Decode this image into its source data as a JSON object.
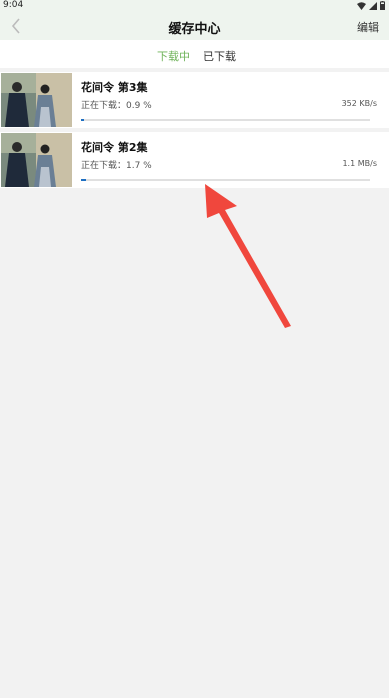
{
  "status_bar": {
    "time": "9:04"
  },
  "header": {
    "title": "缓存中心",
    "edit_label": "编辑"
  },
  "tabs": [
    {
      "label": "下载中",
      "active": true
    },
    {
      "label": "已下载",
      "active": false
    }
  ],
  "downloads": [
    {
      "title": "花间令  第3集",
      "status": "正在下载：0.9 %",
      "speed": "352 KB/s",
      "progress": 0.009
    },
    {
      "title": "花间令  第2集",
      "status": "正在下载：1.7 %",
      "speed": "1.1 MB/s",
      "progress": 0.017
    }
  ],
  "colors": {
    "accent_tab": "#6fb35a",
    "progress": "#1e6fc2",
    "annotation_arrow": "#f0473d"
  },
  "icons": {
    "back": "chevron-left-icon",
    "wifi": "wifi-icon",
    "signal": "signal-icon",
    "battery": "battery-icon"
  }
}
